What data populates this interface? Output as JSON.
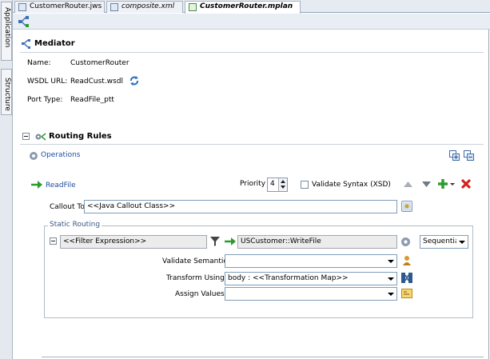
{
  "side_tabs": {
    "application": "Application",
    "structure": "Structure"
  },
  "tabs": [
    {
      "label": "CustomerRouter.jws",
      "active": false
    },
    {
      "label": "composite.xml",
      "active": false
    },
    {
      "label": "CustomerRouter.mplan",
      "active": true
    }
  ],
  "mediator": {
    "title": "Mediator",
    "name_label": "Name:",
    "name_value": "CustomerRouter",
    "wsdl_label": "WSDL URL:",
    "wsdl_value": "ReadCust.wsdl",
    "port_label": "Port Type:",
    "port_value": "ReadFile_ptt"
  },
  "routing": {
    "title": "Routing Rules",
    "operations_label": "Operations",
    "operation_name": "ReadFile",
    "priority_label": "Priority",
    "priority_value": "4",
    "validate_syntax_label": "Validate Syntax (XSD)",
    "callout_label": "Callout To",
    "callout_value": "<<Java Callout Class>>",
    "static_routing_label": "Static Routing",
    "filter_value": "<<Filter Expression>>",
    "target_value": "USCustomer::WriteFile",
    "execution_value": "Sequential",
    "validate_semantic_label": "Validate Semantic",
    "validate_semantic_value": "",
    "transform_label": "Transform Using",
    "transform_value": "body : <<Transformation Map>>",
    "assign_label": "Assign Values",
    "assign_value": ""
  },
  "colors": {
    "link": "#1e4fa0",
    "green_arrow": "#2e9b2e",
    "red_x": "#d2201a"
  }
}
